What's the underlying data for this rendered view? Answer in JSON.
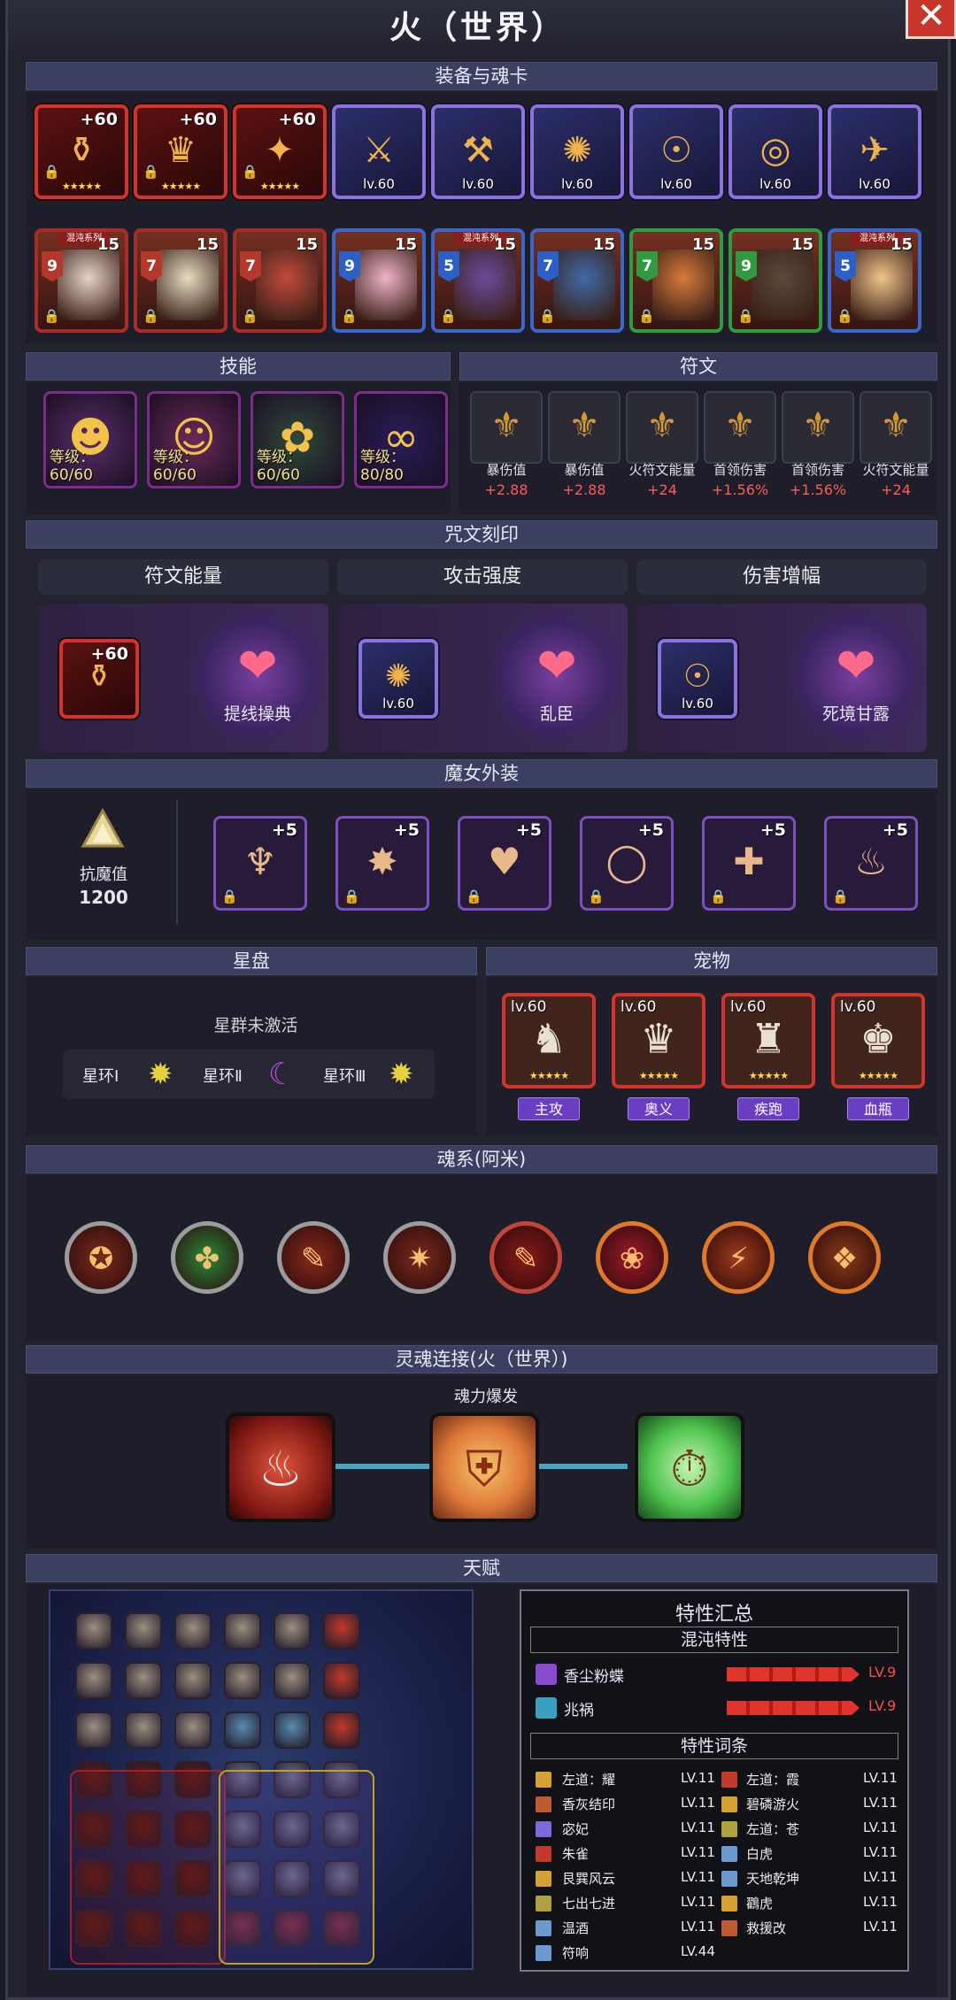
{
  "title": "火（世界）",
  "close": "✕",
  "sections": {
    "equip": "装备与魂卡",
    "skills": "技能",
    "runes": "符文",
    "engrave": "咒文刻印",
    "outfit": "魔女外装",
    "star": "星盘",
    "pet": "宠物",
    "soul": "魂系(阿米)",
    "link": "灵魂连接(火（世界）)",
    "talent": "天赋"
  },
  "equip": [
    {
      "label": "+60",
      "kind": "plus"
    },
    {
      "label": "+60",
      "kind": "plus"
    },
    {
      "label": "+60",
      "kind": "plus"
    },
    {
      "label": "lv.60",
      "kind": "lv"
    },
    {
      "label": "lv.60",
      "kind": "lv"
    },
    {
      "label": "lv.60",
      "kind": "lv"
    },
    {
      "label": "lv.60",
      "kind": "lv"
    },
    {
      "label": "lv.60",
      "kind": "lv"
    },
    {
      "label": "lv.60",
      "kind": "lv"
    }
  ],
  "stars": "★★★★★",
  "cards": [
    {
      "num": "15",
      "badge": "9",
      "series": "混沌系列"
    },
    {
      "num": "15",
      "badge": "7",
      "series": ""
    },
    {
      "num": "15",
      "badge": "7",
      "series": ""
    },
    {
      "num": "15",
      "badge": "9",
      "series": ""
    },
    {
      "num": "15",
      "badge": "5",
      "series": "混沌系列"
    },
    {
      "num": "15",
      "badge": "7",
      "series": ""
    },
    {
      "num": "15",
      "badge": "7",
      "series": ""
    },
    {
      "num": "15",
      "badge": "9",
      "series": ""
    },
    {
      "num": "15",
      "badge": "5",
      "series": "混沌系列"
    }
  ],
  "skills": [
    {
      "level": "等级：60/60"
    },
    {
      "level": "等级：60/60"
    },
    {
      "level": "等级：60/60"
    },
    {
      "level": "等级：80/80"
    }
  ],
  "runes": [
    {
      "name": "暴伤值",
      "value": "+2.88"
    },
    {
      "name": "暴伤值",
      "value": "+2.88"
    },
    {
      "name": "火符文能量",
      "value": "+24"
    },
    {
      "name": "首领伤害",
      "value": "+1.56%"
    },
    {
      "name": "首领伤害",
      "value": "+1.56%"
    },
    {
      "name": "火符文能量",
      "value": "+24"
    }
  ],
  "engrave": [
    {
      "head": "符文能量",
      "item": "+60",
      "glyph": "提线操典"
    },
    {
      "head": "攻击强度",
      "item": "lv.60",
      "glyph": "乱臣"
    },
    {
      "head": "伤害增幅",
      "item": "lv.60",
      "glyph": "死境甘露"
    }
  ],
  "outfit": {
    "resist_label": "抗魔值",
    "resist_value": "1200",
    "items": [
      "+5",
      "+5",
      "+5",
      "+5",
      "+5",
      "+5"
    ]
  },
  "star": {
    "status": "星群未激活",
    "rings": [
      "星环Ⅰ",
      "星环Ⅱ",
      "星环Ⅲ"
    ]
  },
  "pets": [
    {
      "lv": "lv.60",
      "tag": "主攻"
    },
    {
      "lv": "lv.60",
      "tag": "奥义"
    },
    {
      "lv": "lv.60",
      "tag": "疾跑"
    },
    {
      "lv": "lv.60",
      "tag": "血瓶"
    }
  ],
  "link": {
    "label": "魂力爆发"
  },
  "traits": {
    "title": "特性汇总",
    "chaos_head": "混沌特性",
    "chaos": [
      {
        "name": "香尘粉蝶",
        "lv": "LV.9"
      },
      {
        "name": "兆祸",
        "lv": "LV.9"
      }
    ],
    "entries_head": "特性词条",
    "left": [
      {
        "n": "左道：耀",
        "l": "LV.11"
      },
      {
        "n": "香灰结印",
        "l": "LV.11"
      },
      {
        "n": "宓妃",
        "l": "LV.11"
      },
      {
        "n": "朱雀",
        "l": "LV.11"
      },
      {
        "n": "艮巽风云",
        "l": "LV.11"
      },
      {
        "n": "七出七进",
        "l": "LV.11"
      },
      {
        "n": "温酒",
        "l": "LV.11"
      },
      {
        "n": "符响",
        "l": "LV.44"
      }
    ],
    "right": [
      {
        "n": "左道：霞",
        "l": "LV.11"
      },
      {
        "n": "碧磷游火",
        "l": "LV.11"
      },
      {
        "n": "左道：苍",
        "l": "LV.11"
      },
      {
        "n": "白虎",
        "l": "LV.11"
      },
      {
        "n": "天地乾坤",
        "l": "LV.11"
      },
      {
        "n": "鸐虎",
        "l": "LV.11"
      },
      {
        "n": "救援改",
        "l": "LV.11"
      }
    ]
  },
  "colors": {
    "accent": "#3b3f60",
    "red": "#d2342d",
    "purple": "#8a72e0",
    "value_red": "#ff5a5a"
  }
}
